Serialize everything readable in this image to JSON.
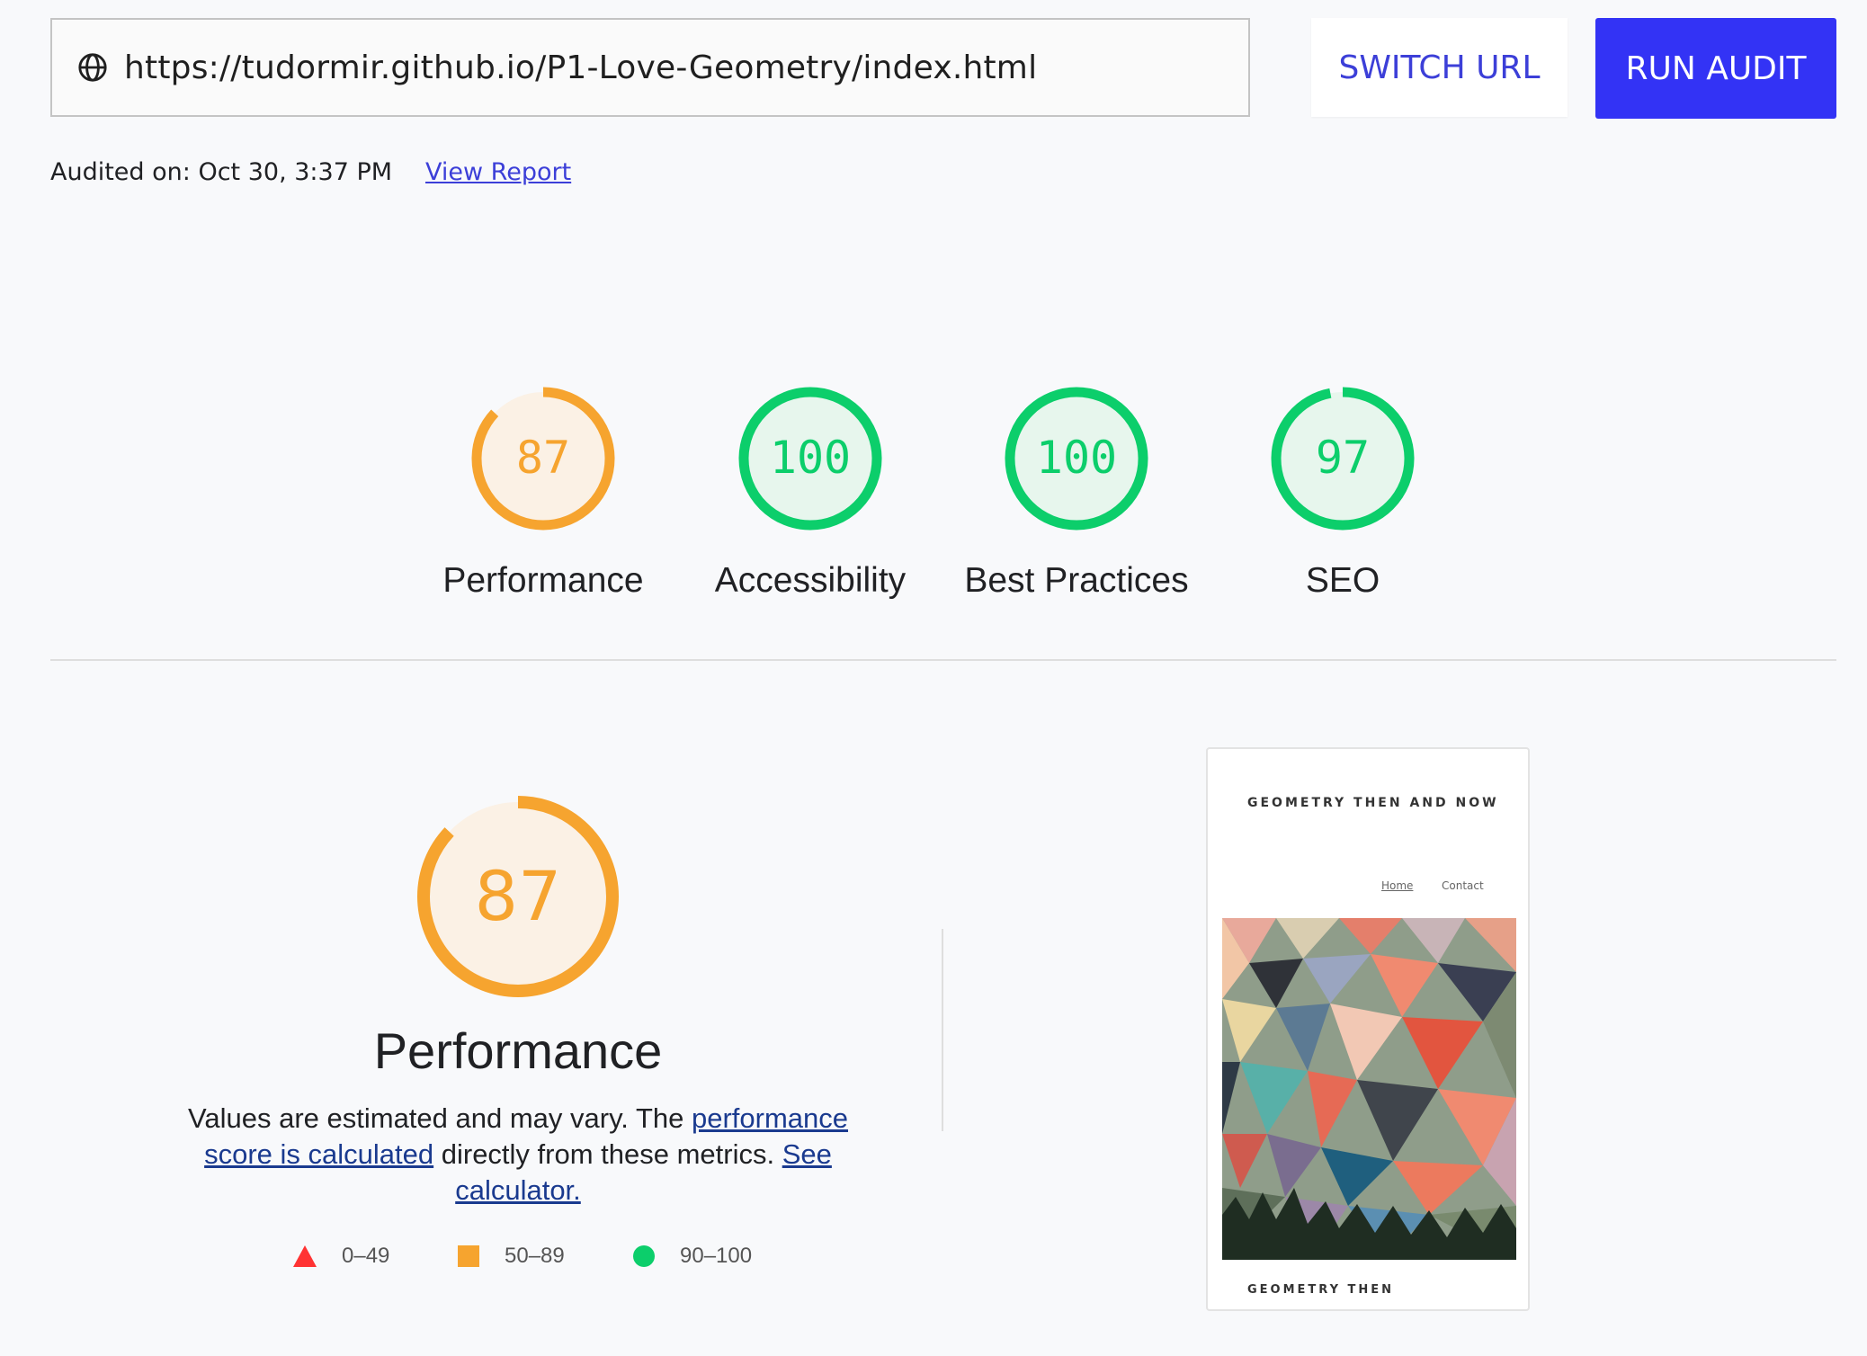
{
  "toolbar": {
    "url": "https://tudormir.github.io/P1-Love-Geometry/index.html",
    "switch_label": "SWITCH URL",
    "run_label": "RUN AUDIT",
    "globe_icon": "globe-icon"
  },
  "audit": {
    "audited_on": "Audited on: Oct 30, 3:37 PM",
    "view_report": "View Report"
  },
  "gauges": [
    {
      "score": "87",
      "label": "Performance",
      "fraction": 0.87,
      "color": "#f6a42f",
      "fill": "#fbf1e5"
    },
    {
      "score": "100",
      "label": "Accessibility",
      "fraction": 1.0,
      "color": "#0cce6b",
      "fill": "#e7f6ed"
    },
    {
      "score": "100",
      "label": "Best Practices",
      "fraction": 1.0,
      "color": "#0cce6b",
      "fill": "#e7f6ed"
    },
    {
      "score": "97",
      "label": "SEO",
      "fraction": 0.97,
      "color": "#0cce6b",
      "fill": "#e7f6ed"
    }
  ],
  "performance": {
    "score": "87",
    "fraction": 0.87,
    "title": "Performance",
    "desc_prefix": "Values are estimated and may vary. The ",
    "desc_link1": "performance score is calculated",
    "desc_mid": " directly from these metrics. ",
    "desc_link2": "See calculator."
  },
  "legend": [
    {
      "range": "0–49",
      "shape": "triangle",
      "color": "#ff3333"
    },
    {
      "range": "50–89",
      "shape": "square",
      "color": "#f6a42f"
    },
    {
      "range": "90–100",
      "shape": "circle",
      "color": "#0cce6b"
    }
  ],
  "preview": {
    "title": "GEOMETRY THEN AND NOW",
    "nav_home": "Home",
    "nav_contact": "Contact",
    "footer_text": "GEOMETRY THEN"
  }
}
